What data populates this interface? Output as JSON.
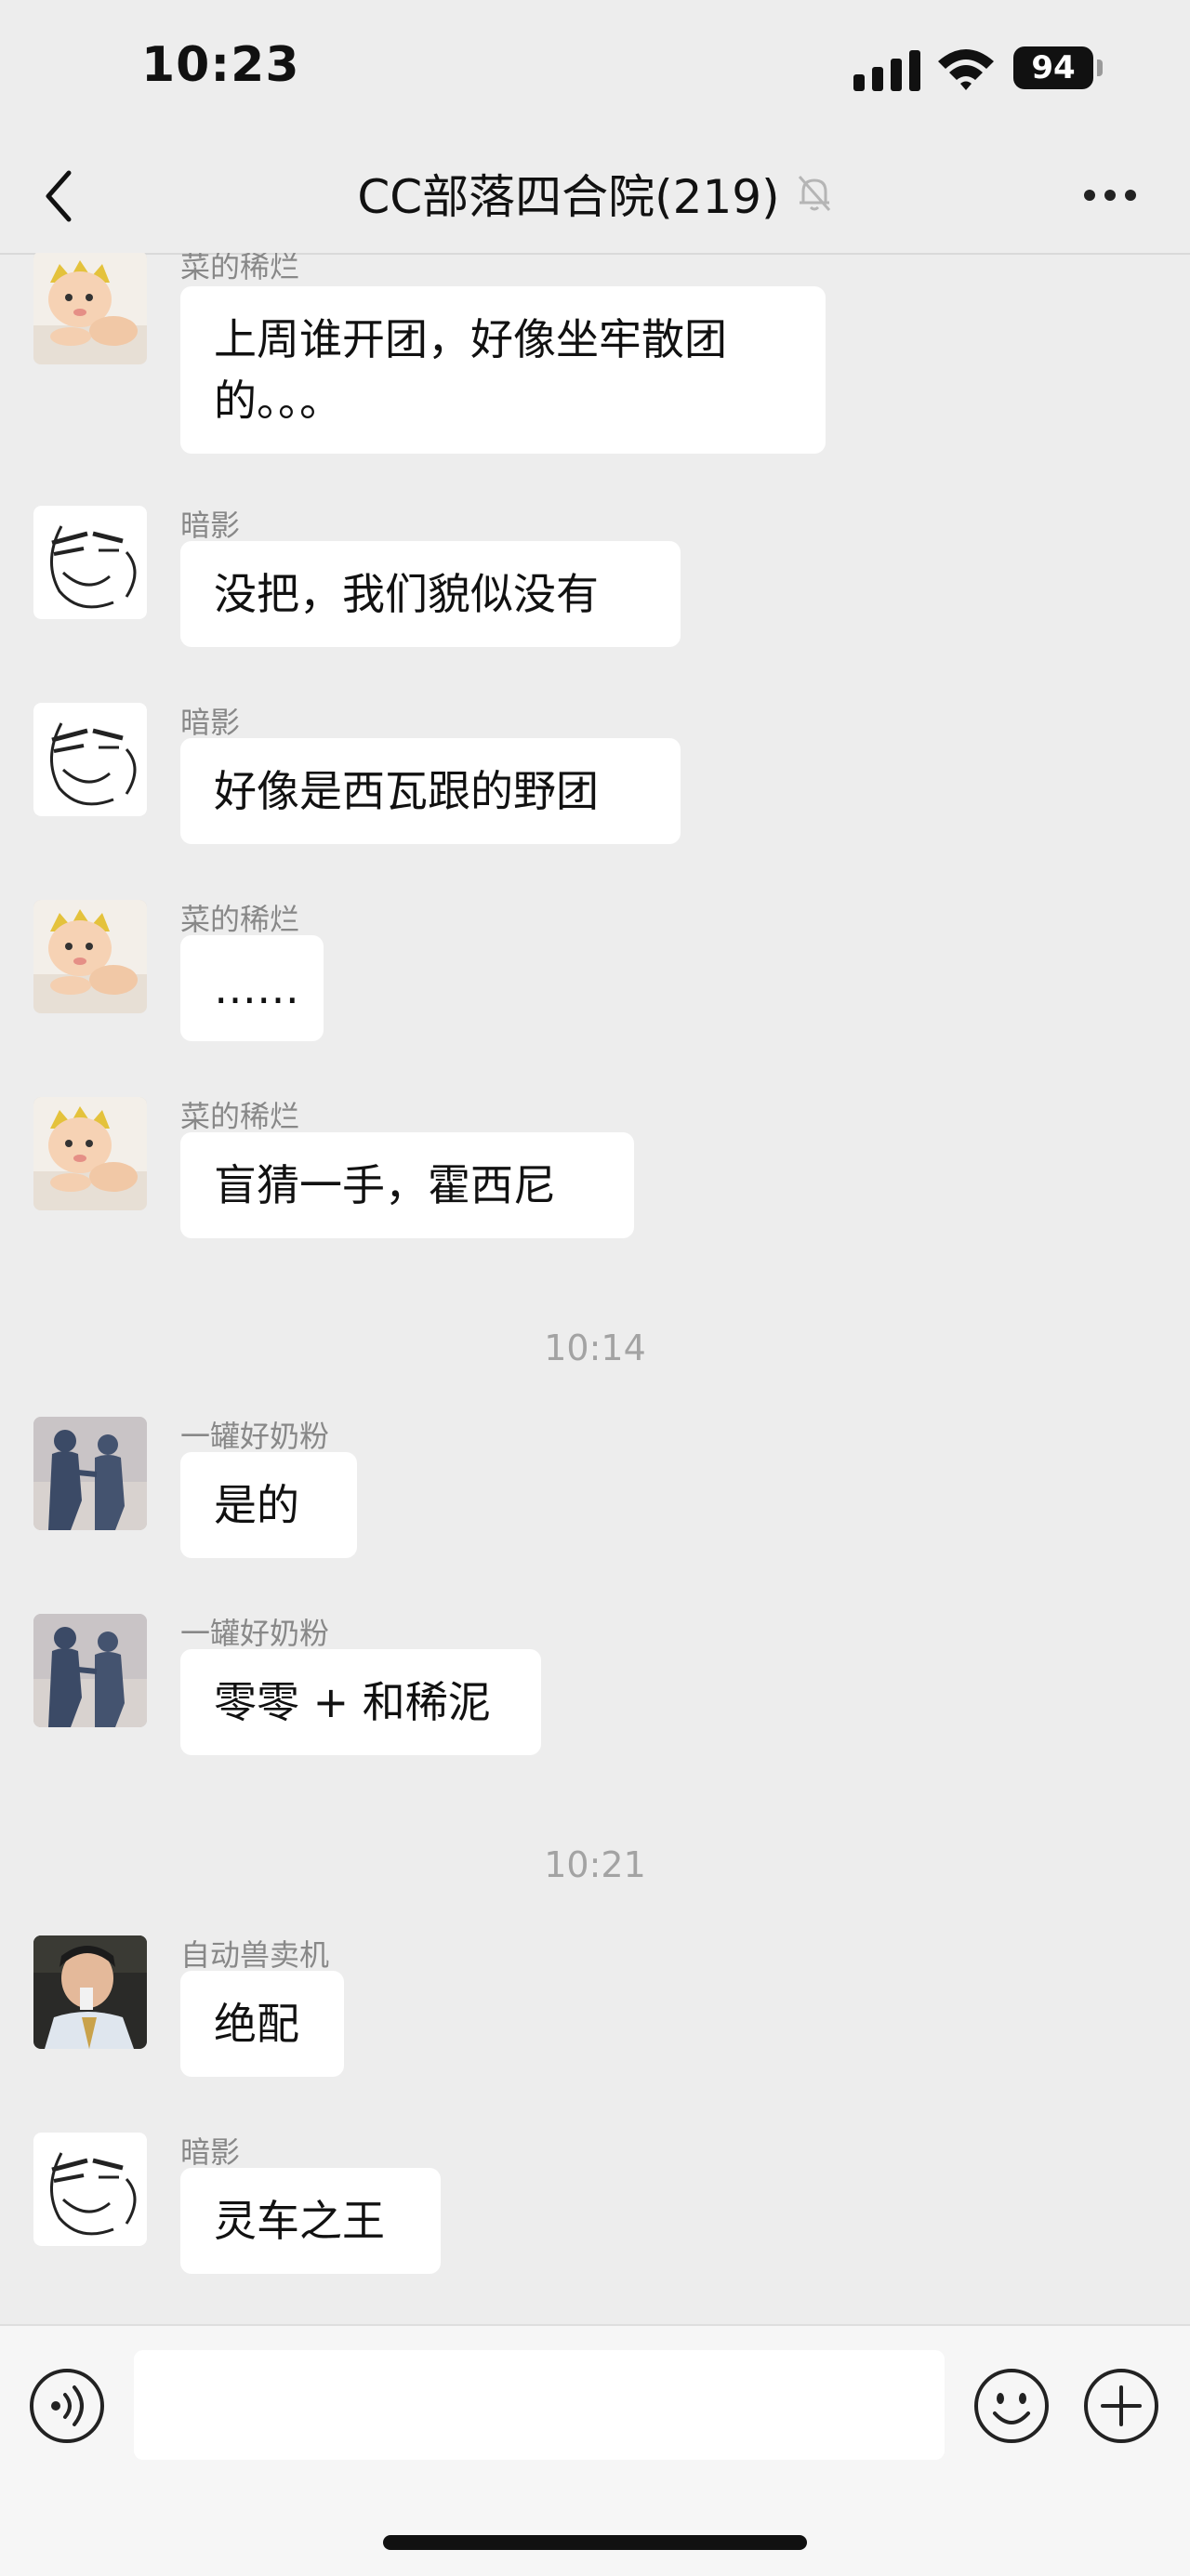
{
  "status_bar": {
    "time": "10:23",
    "battery": "94"
  },
  "nav": {
    "title": "CC部落四合院(219)",
    "back_icon": "chevron-left-icon",
    "mute_icon": "bell-muted-icon",
    "more_icon": "more-dots-icon"
  },
  "messages": [
    {
      "sender": "菜的稀烂",
      "text": "上周谁开团，好像坐牢散团的。。。",
      "avatar": "baby"
    },
    {
      "sender": "暗影",
      "text": "没把，我们貌似没有",
      "avatar": "meme"
    },
    {
      "sender": "暗影",
      "text": "好像是西瓦跟的野团",
      "avatar": "meme"
    },
    {
      "sender": "菜的稀烂",
      "text": "……",
      "avatar": "baby"
    },
    {
      "sender": "菜的稀烂",
      "text": "盲猜一手，霍西尼",
      "avatar": "baby"
    },
    {
      "sender": "一罐好奶粉",
      "text": "是的",
      "avatar": "shadow"
    },
    {
      "sender": "一罐好奶粉",
      "text": "零零 + 和稀泥",
      "avatar": "shadow"
    },
    {
      "sender": "自动兽卖机",
      "text": "绝配",
      "avatar": "man"
    },
    {
      "sender": "暗影",
      "text": "灵车之王",
      "avatar": "meme"
    }
  ],
  "timestamps": [
    "10:14",
    "10:21"
  ],
  "input": {
    "value": "",
    "placeholder": ""
  },
  "colors": {
    "background": "#ededed",
    "bubble": "#ffffff",
    "sender": "#888888",
    "timestamp": "#a3a3a3"
  }
}
